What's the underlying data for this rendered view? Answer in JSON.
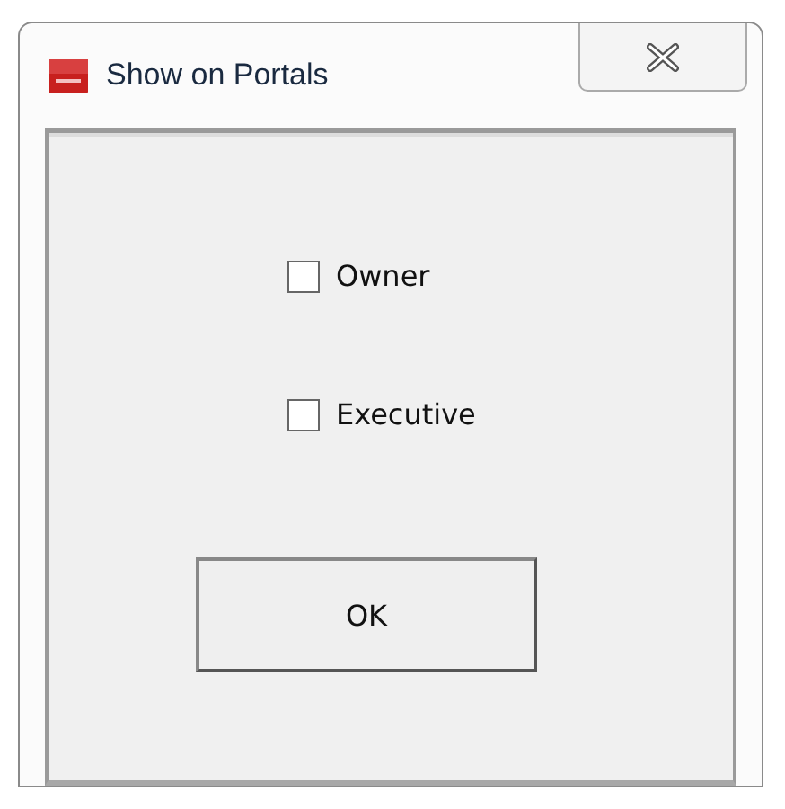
{
  "window": {
    "title": "Show on Portals"
  },
  "options": [
    {
      "label": "Owner",
      "checked": false
    },
    {
      "label": "Executive",
      "checked": false
    }
  ],
  "buttons": [
    "OK"
  ]
}
